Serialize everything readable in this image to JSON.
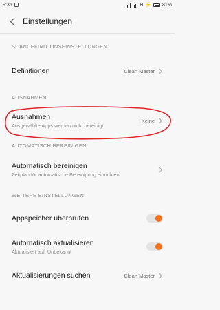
{
  "status_bar": {
    "time": "9:36",
    "network": "H",
    "battery": "81%"
  },
  "header": {
    "title": "Einstellungen"
  },
  "sections": {
    "scan": {
      "header": "SCANDEFINITIONSEINSTELLUNGEN",
      "definitionen": {
        "title": "Definitionen",
        "value": "Clean Master"
      }
    },
    "ausnahmen": {
      "header": "AUSNAHMEN",
      "item": {
        "title": "Ausnahmen",
        "subtitle": "Ausgewählte Apps werden nicht bereinigt",
        "value": "Keine"
      }
    },
    "auto": {
      "header": "AUTOMATISCH BEREINIGEN",
      "item": {
        "title": "Automatisch bereinigen",
        "subtitle": "Zeitplan für automatische Bereinigung einrichten"
      }
    },
    "weitere": {
      "header": "WEITERE EINSTELLUNGEN",
      "appspeicher": {
        "title": "Appspeicher überprüfen",
        "toggle_on": true
      },
      "auto_update": {
        "title": "Automatisch aktualisieren",
        "subtitle": "Aktualisiert auf: Unbekannt",
        "toggle_on": true
      },
      "suchen": {
        "title": "Aktualisierungen suchen",
        "value": "Clean Master"
      }
    }
  },
  "colors": {
    "accent": "#f2711c",
    "annotation": "#e0262a"
  }
}
